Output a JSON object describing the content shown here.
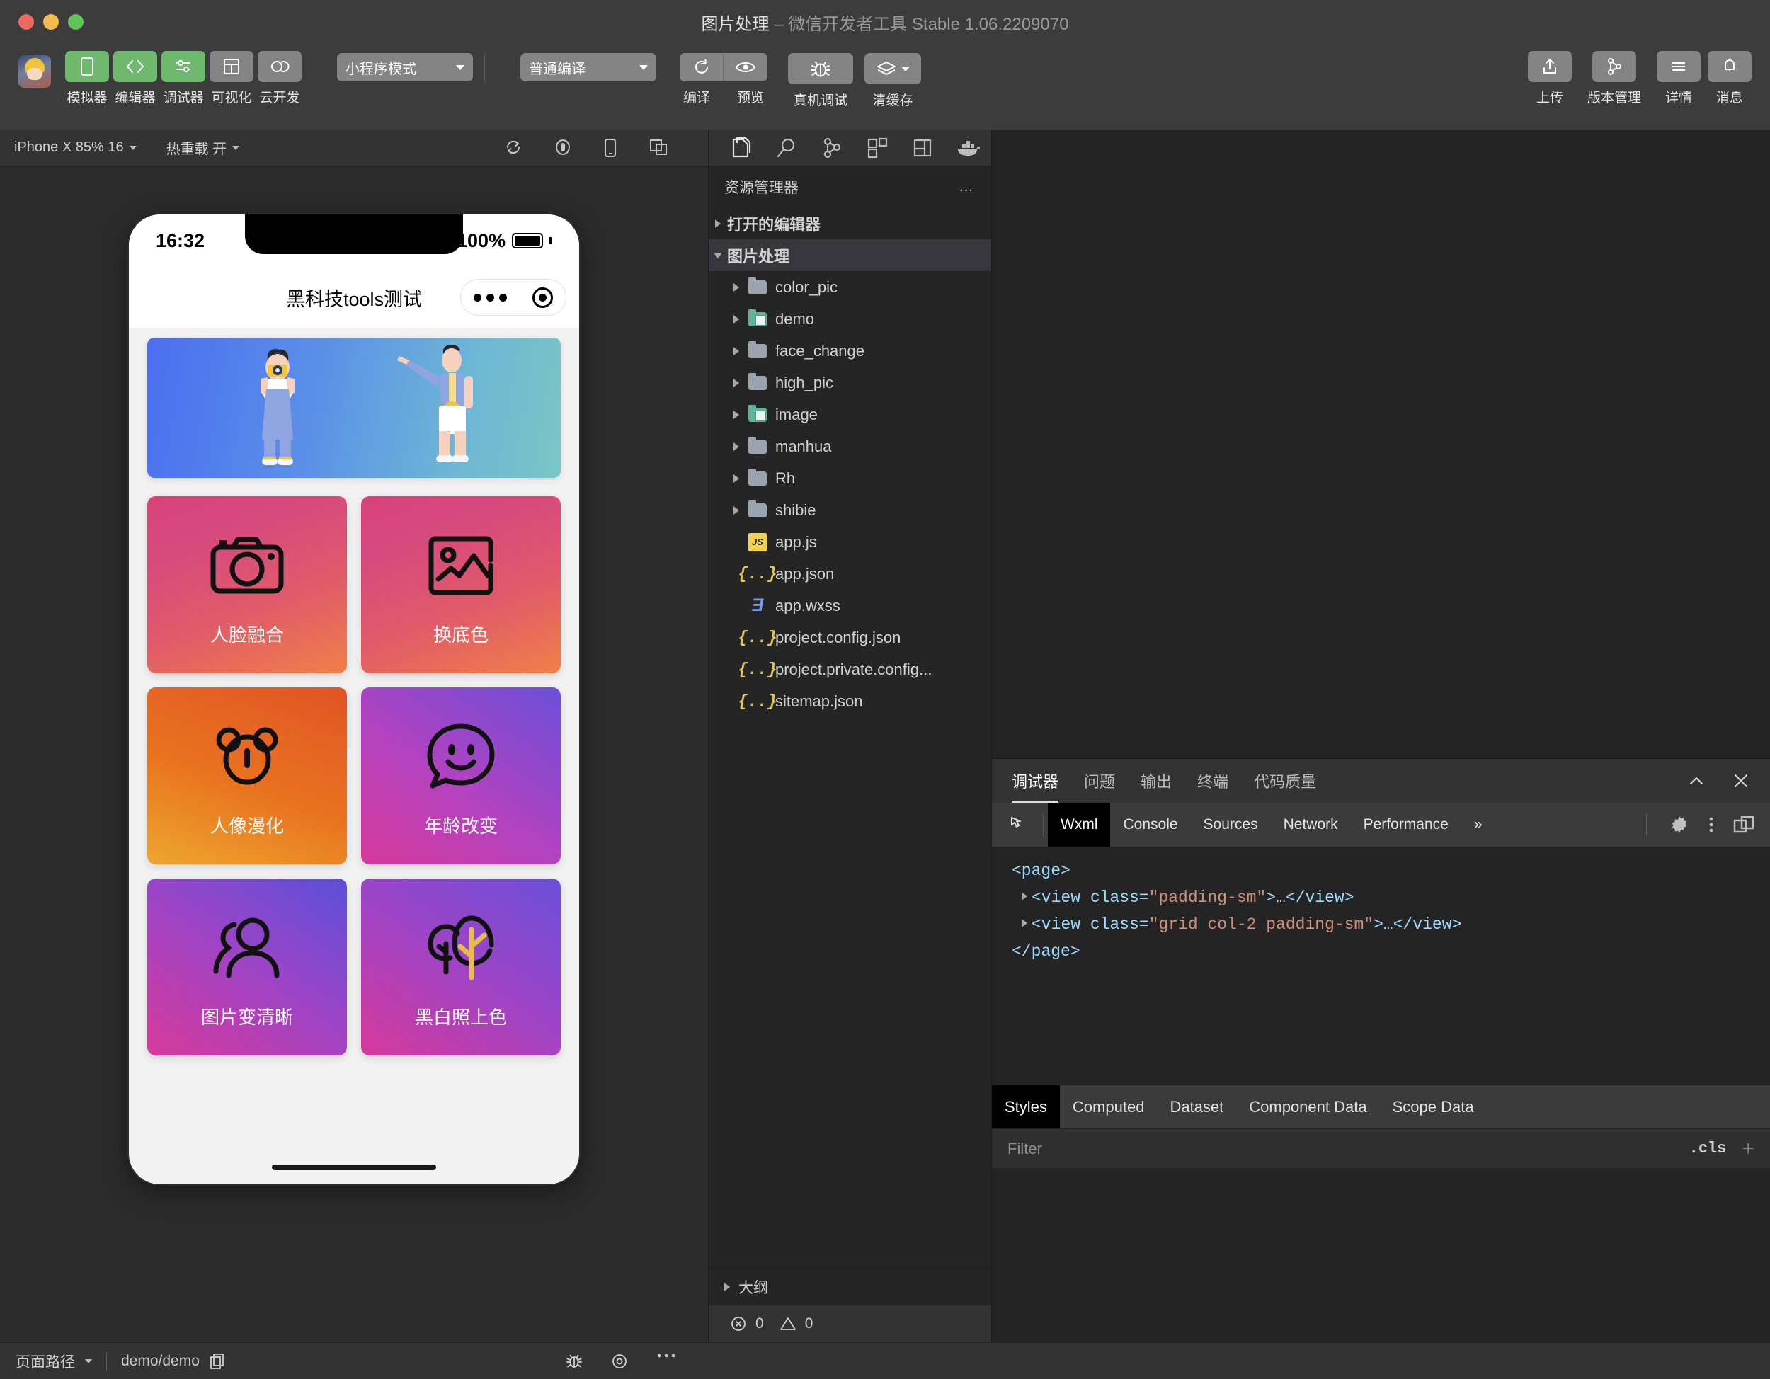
{
  "window": {
    "title_project": "图片处理",
    "title_sep": " – ",
    "title_app": "微信开发者工具 Stable 1.06.2209070"
  },
  "toolbar": {
    "items": [
      {
        "label": "模拟器",
        "icon": "phone-icon",
        "active": true
      },
      {
        "label": "编辑器",
        "icon": "code-icon",
        "active": true
      },
      {
        "label": "调试器",
        "icon": "sliders-icon",
        "active": true
      },
      {
        "label": "可视化",
        "icon": "layout-icon",
        "active": false
      },
      {
        "label": "云开发",
        "icon": "cloud-icon",
        "active": false
      }
    ],
    "mode_select": "小程序模式",
    "compile_select": "普通编译",
    "actions": [
      {
        "label": "编译",
        "icon": "refresh-icon"
      },
      {
        "label": "预览",
        "icon": "eye-icon"
      },
      {
        "label": "真机调试",
        "icon": "bug-icon"
      },
      {
        "label": "清缓存",
        "icon": "layers-icon"
      }
    ],
    "right_actions": [
      {
        "label": "上传",
        "icon": "upload-icon"
      },
      {
        "label": "版本管理",
        "icon": "git-branch-icon"
      },
      {
        "label": "详情",
        "icon": "menu-icon"
      },
      {
        "label": "消息",
        "icon": "bell-icon"
      }
    ]
  },
  "simulator": {
    "device": "iPhone X 85% 16",
    "hot_reload": "热重载 开",
    "toolbar_icons": [
      "rotate-icon",
      "record-icon",
      "device-icon",
      "window-icon"
    ],
    "phone": {
      "time": "16:32",
      "battery": "100%",
      "nav_title": "黑科技tools测试",
      "cards": [
        {
          "label": "人脸融合",
          "icon": "camera-icon",
          "gradient": "linear-gradient(160deg,#d8417a 0%,#d64a7e 25%,#e05a6a 60%,#ef8048 100%)"
        },
        {
          "label": "换底色",
          "icon": "image-icon",
          "gradient": "linear-gradient(160deg,#d8417a 0%,#d64a7e 25%,#e05a6a 60%,#ef8048 100%)"
        },
        {
          "label": "人像漫化",
          "icon": "bear-icon",
          "gradient": "linear-gradient(200deg,#e05426 0%,#e9731f 55%,#eda62f 100%)"
        },
        {
          "label": "年龄改变",
          "icon": "smiley-chat-icon",
          "gradient": "linear-gradient(35deg,#d6399a 0%,#b342c0 45%,#6b4fd8 100%)"
        },
        {
          "label": "图片变清晰",
          "icon": "users-icon",
          "gradient": "linear-gradient(35deg,#d6399a 0%,#a044c6 50%,#5a4fd8 100%)"
        },
        {
          "label": "黑白照上色",
          "icon": "trees-icon",
          "gradient": "linear-gradient(35deg,#d6399a 0%,#a044c6 50%,#6a4fd8 100%)"
        }
      ]
    }
  },
  "explorer": {
    "tabs": [
      "files-icon",
      "search-icon",
      "git-icon",
      "extensions-icon",
      "layout2-icon",
      "docker-icon"
    ],
    "header": "资源管理器",
    "more": "…",
    "tree": [
      {
        "label": "打开的编辑器",
        "depth": 0,
        "type": "section",
        "expanded": false
      },
      {
        "label": "图片处理",
        "depth": 0,
        "type": "section",
        "expanded": true,
        "selected": true
      },
      {
        "label": "color_pic",
        "depth": 1,
        "type": "folder",
        "expanded": false
      },
      {
        "label": "demo",
        "depth": 1,
        "type": "folder-green",
        "expanded": false
      },
      {
        "label": "face_change",
        "depth": 1,
        "type": "folder",
        "expanded": false
      },
      {
        "label": "high_pic",
        "depth": 1,
        "type": "folder",
        "expanded": false
      },
      {
        "label": "image",
        "depth": 1,
        "type": "folder-green",
        "expanded": false
      },
      {
        "label": "manhua",
        "depth": 1,
        "type": "folder",
        "expanded": false
      },
      {
        "label": "Rh",
        "depth": 1,
        "type": "folder",
        "expanded": false
      },
      {
        "label": "shibie",
        "depth": 1,
        "type": "folder",
        "expanded": false
      },
      {
        "label": "app.js",
        "depth": 1,
        "type": "js"
      },
      {
        "label": "app.json",
        "depth": 1,
        "type": "json"
      },
      {
        "label": "app.wxss",
        "depth": 1,
        "type": "css"
      },
      {
        "label": "project.config.json",
        "depth": 1,
        "type": "json"
      },
      {
        "label": "project.private.config...",
        "depth": 1,
        "type": "json"
      },
      {
        "label": "sitemap.json",
        "depth": 1,
        "type": "json"
      }
    ],
    "outline": "大纲",
    "problems": {
      "errors": "0",
      "warnings": "0"
    }
  },
  "devtools": {
    "panel_tabs": [
      "调试器",
      "问题",
      "输出",
      "终端",
      "代码质量"
    ],
    "panel_active": "调试器",
    "collapse_icon": "chevron-up-icon",
    "close_icon": "close-icon",
    "inspector_tabs": [
      "Wxml",
      "Console",
      "Sources",
      "Network",
      "Performance"
    ],
    "inspector_active": "Wxml",
    "overflow": "»",
    "right_icons": [
      "gear-icon",
      "kebab-icon",
      "dock-icon"
    ],
    "wxml": {
      "line1": "<page>",
      "line2_open": "<view class=",
      "line2_val": "\"padding-sm\"",
      "line2_close": ">…</view>",
      "line3_open": "<view class=",
      "line3_val": "\"grid col-2 padding-sm\"",
      "line3_close": ">…</view>",
      "line4": "</page>"
    },
    "style_tabs": [
      "Styles",
      "Computed",
      "Dataset",
      "Component Data",
      "Scope Data"
    ],
    "style_active": "Styles",
    "filter_placeholder": "Filter",
    "cls_label": ".cls",
    "plus_label": "+"
  },
  "statusbar": {
    "page_path_label": "页面路径",
    "page_path_value": "demo/demo",
    "copy_icon": "copy-icon",
    "icons": [
      "bug-icon",
      "eye-circle-icon",
      "ellipsis-icon"
    ]
  }
}
